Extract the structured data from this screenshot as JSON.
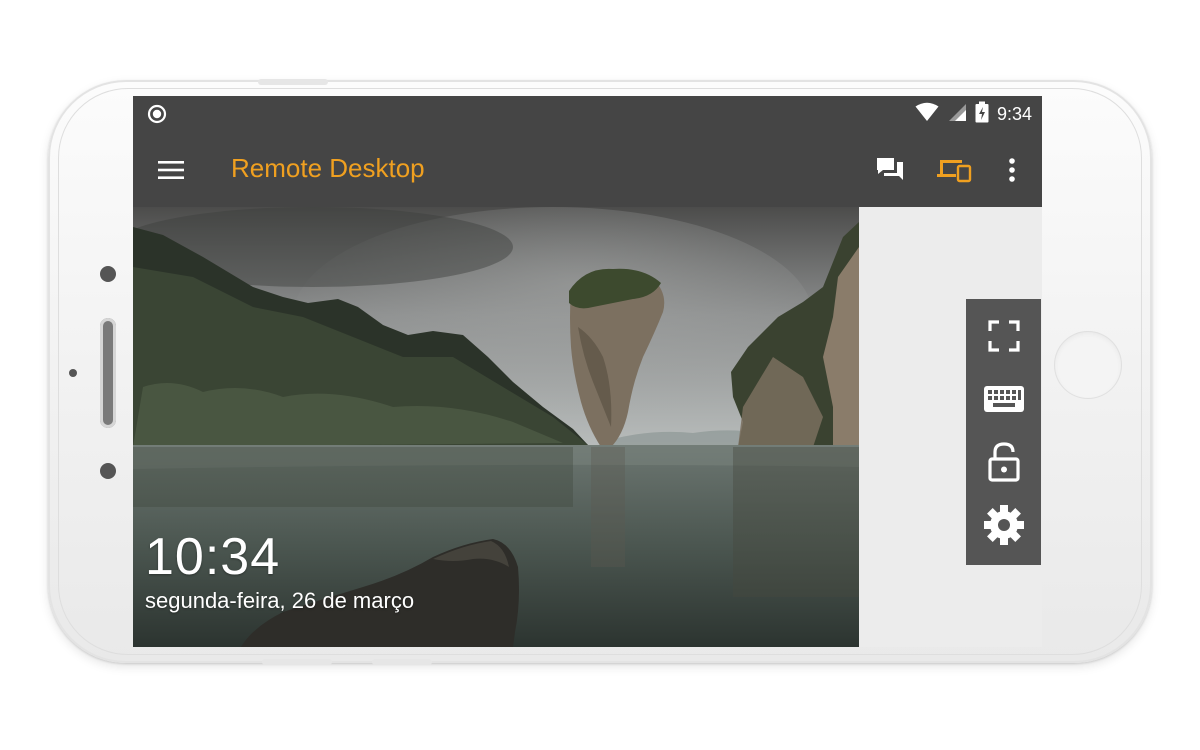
{
  "app": {
    "title": "Remote Desktop",
    "accent_color": "#f0a020",
    "toolbar_color": "#454545"
  },
  "status_bar": {
    "time": "9:34",
    "icons": [
      "record-dot-icon",
      "wifi-icon",
      "signal-icon",
      "battery-charging-icon"
    ]
  },
  "app_bar": {
    "menu_icon": "hamburger-menu-icon",
    "actions": [
      {
        "name": "chat-icon",
        "active": false
      },
      {
        "name": "devices-icon",
        "active": true
      },
      {
        "name": "more-vert-icon",
        "active": false
      }
    ]
  },
  "remote_session": {
    "lock_screen_time": "10:34",
    "lock_screen_date": "segunda-feira, 26 de março"
  },
  "side_panel": {
    "color": "#555555",
    "buttons": [
      "fullscreen-icon",
      "keyboard-icon",
      "unlock-icon",
      "settings-gear-icon"
    ]
  }
}
